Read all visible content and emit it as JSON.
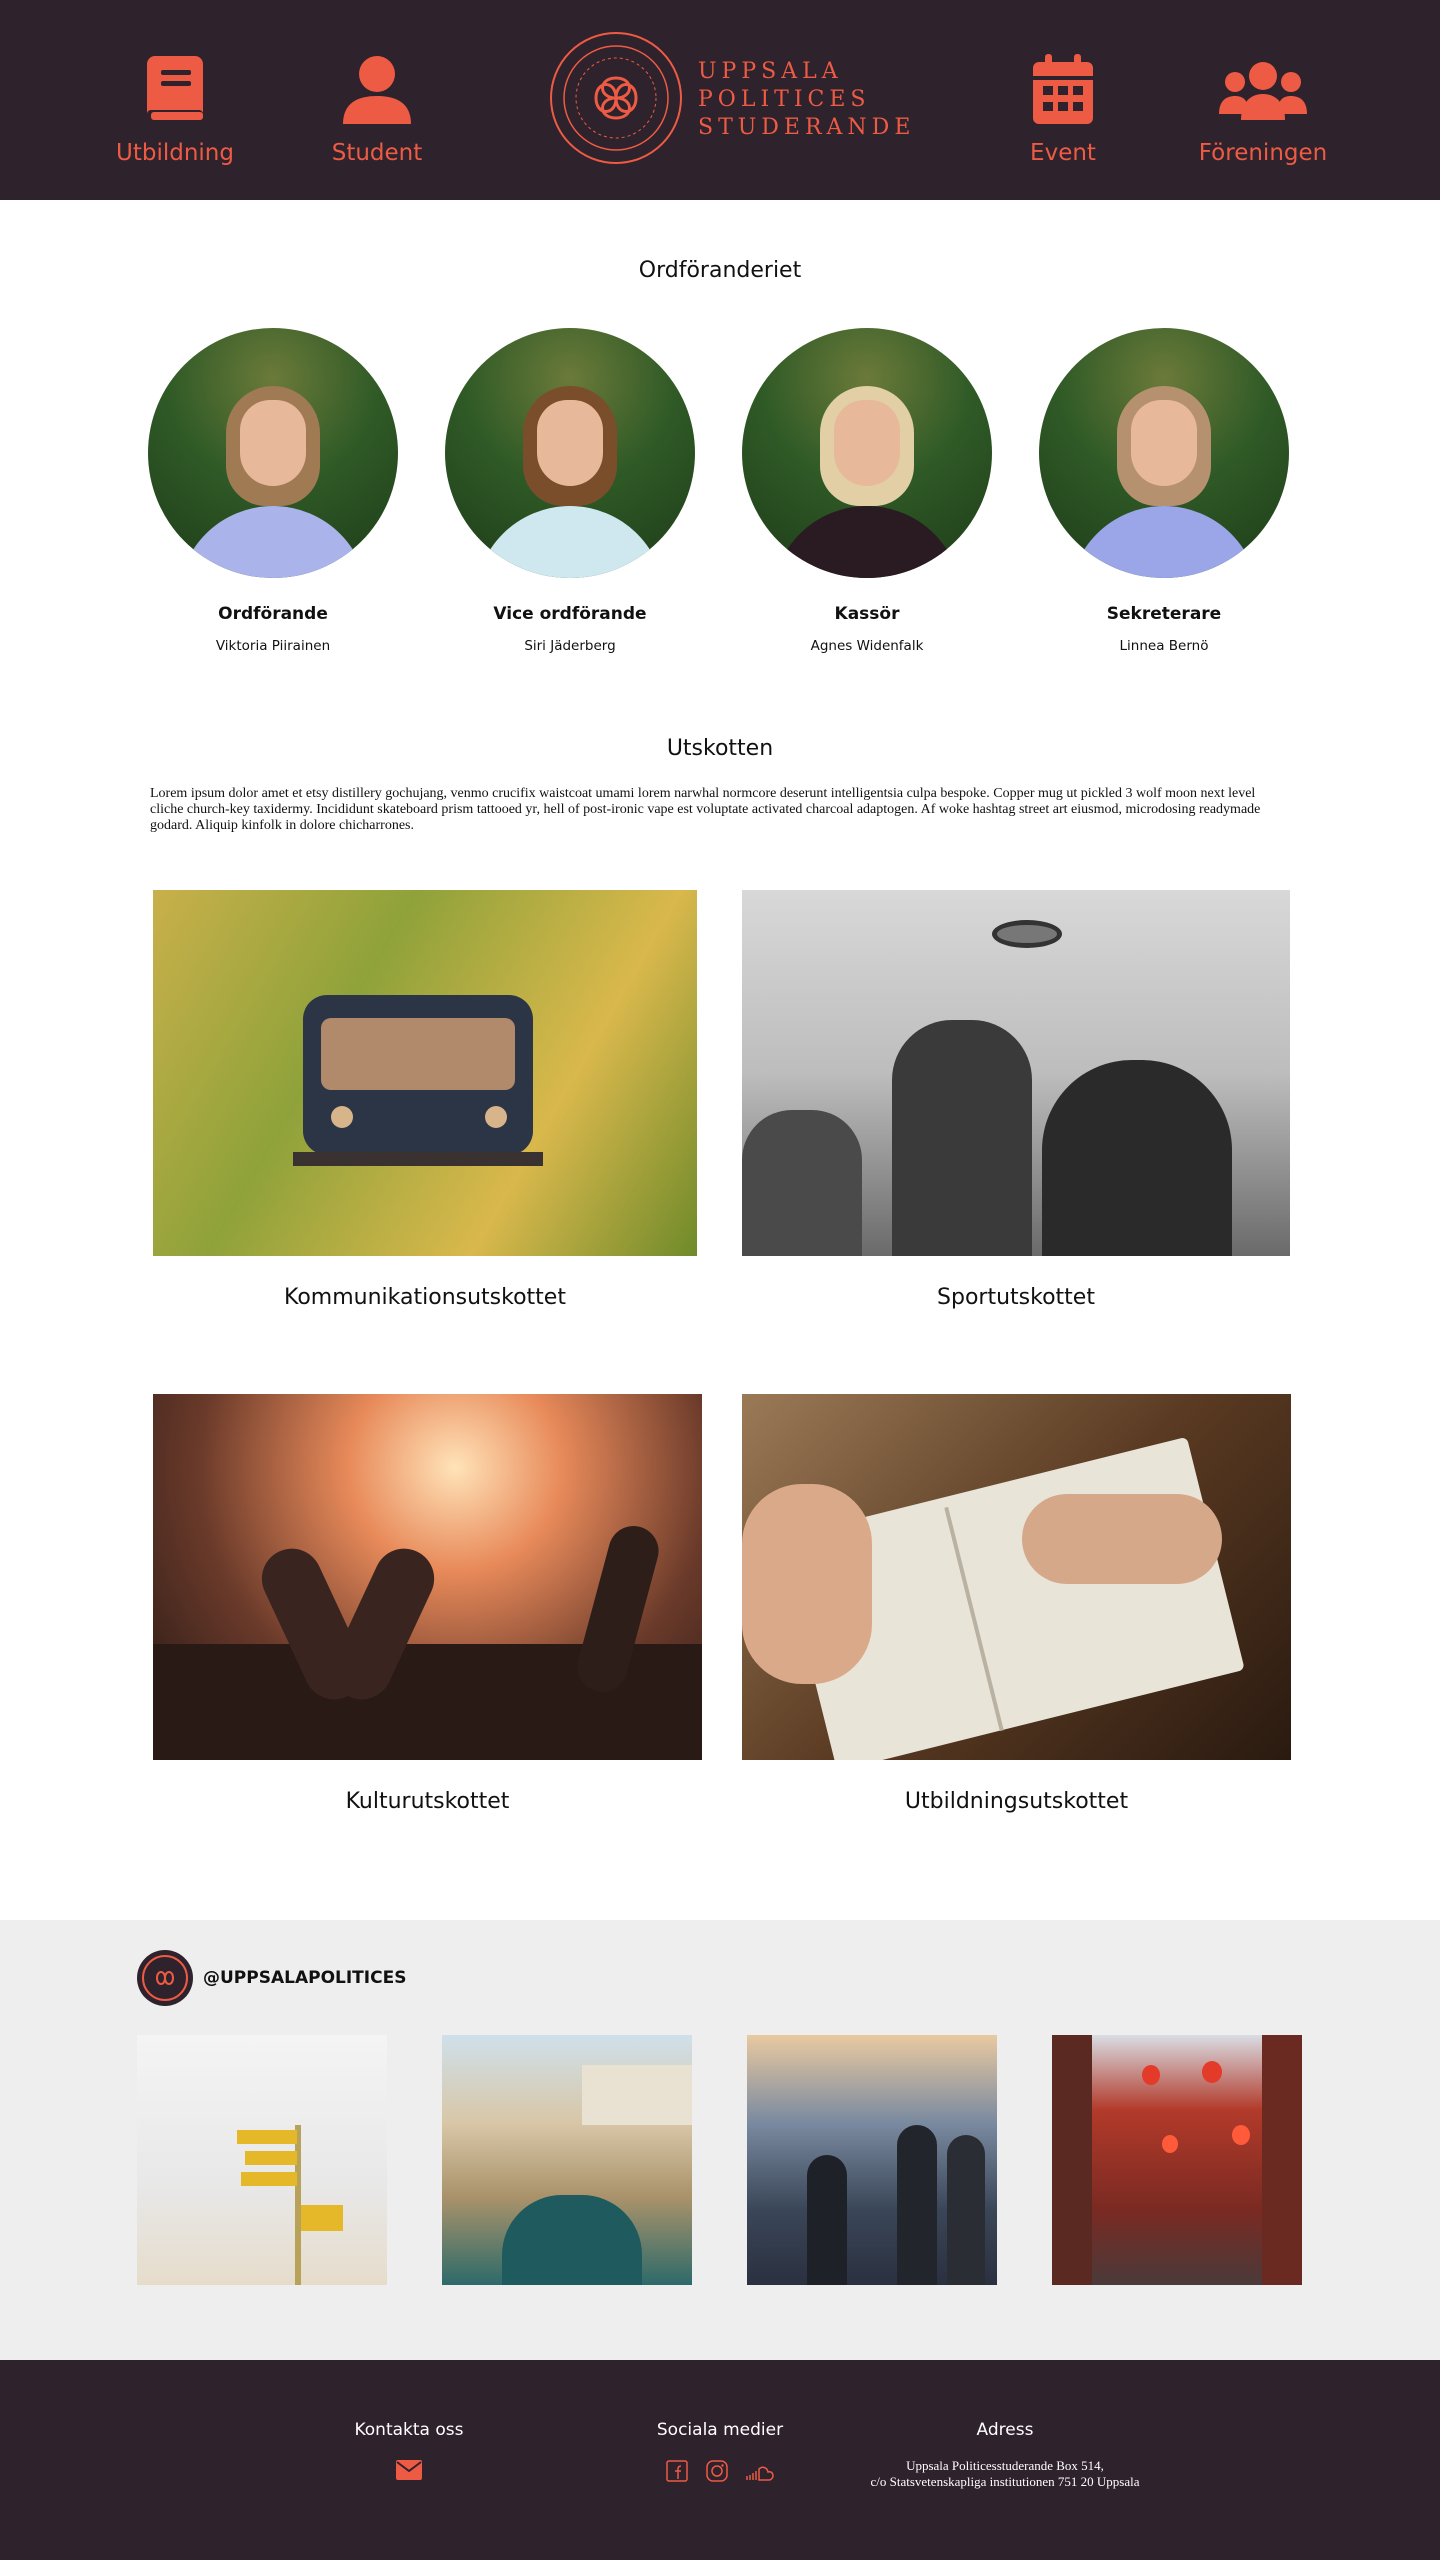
{
  "header": {
    "nav": [
      {
        "label": "Utbildning",
        "icon": "book-icon"
      },
      {
        "label": "Student",
        "icon": "user-icon"
      },
      {
        "label": "Event",
        "icon": "calendar-icon"
      },
      {
        "label": "Föreningen",
        "icon": "users-icon"
      }
    ],
    "logo_lines": [
      "UPPSALA",
      "POLITICES",
      "STUDERANDE"
    ]
  },
  "board": {
    "title": "Ordföranderiet",
    "members": [
      {
        "role": "Ordförande",
        "name": "Viktoria Piirainen"
      },
      {
        "role": "Vice ordförande",
        "name": "Siri Jäderberg"
      },
      {
        "role": "Kassör",
        "name": "Agnes Widenfalk"
      },
      {
        "role": "Sekreterare",
        "name": "Linnea Bernö"
      }
    ]
  },
  "committees": {
    "title": "Utskotten",
    "intro": "Lorem ipsum dolor amet et etsy distillery gochujang, venmo crucifix waistcoat umami lorem narwhal normcore deserunt intelligentsia culpa bespoke. Copper mug ut pickled 3 wolf moon next level cliche church-key taxidermy. Incididunt skateboard prism tattooed yr, hell of post-ironic vape est voluptate activated charcoal adaptogen. Af woke hashtag street art eiusmod, microdosing readymade godard. Aliquip kinfolk in dolore chicharrones.",
    "items": [
      {
        "label": "Kommunikationsutskottet"
      },
      {
        "label": "Sportutskottet"
      },
      {
        "label": "Kulturutskottet"
      },
      {
        "label": "Utbildningsutskottet"
      }
    ]
  },
  "instagram": {
    "handle": "@UPPSALAPOLITICES"
  },
  "footer": {
    "contact_title": "Kontakta oss",
    "social_title": "Sociala medier",
    "address_title": "Adress",
    "address_line1": "Uppsala Politicesstuderande Box 514,",
    "address_line2": "c/o Statsvetenskapliga institutionen 751 20 Uppsala"
  },
  "colors": {
    "accent": "#ee5b44",
    "dark": "#2e222c",
    "light_band": "#eeeeee"
  }
}
